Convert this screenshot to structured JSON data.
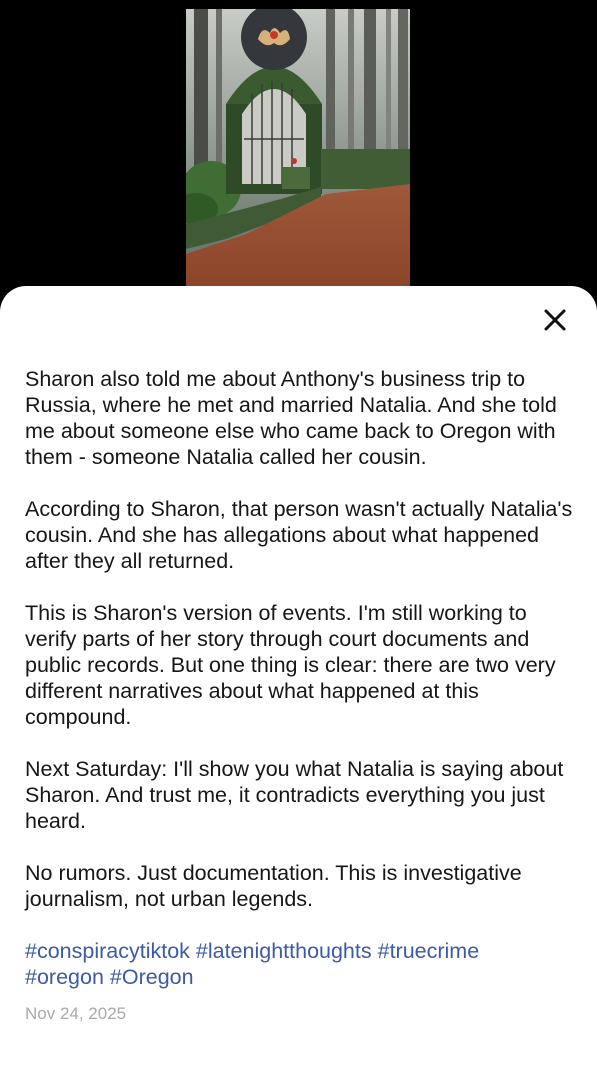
{
  "caption": {
    "paragraphs": [
      "Sharon also told me about Anthony's business trip to Russia, where he met and married Natalia. And she told me about someone else who came back to Oregon with them - someone Natalia called her cousin.",
      "According to Sharon, that person wasn't actually Natalia's cousin. And she has allegations about what happened after they all returned.",
      "This is Sharon's version of events. I'm still working to verify parts of her story through court documents and public records. But one thing is clear: there are two very different narratives about what happened at this compound.",
      "Next Saturday: I'll show you what Natalia is saying about Sharon. And trust me, it contradicts everything you just heard.",
      "No rumors. Just documentation. This is investigative journalism, not urban legends."
    ],
    "hashtags": [
      "#conspiracytiktok",
      "#latenightthoughts",
      "#truecrime",
      "#oregon",
      "#Oregon"
    ],
    "date": "Nov 24, 2025"
  },
  "icons": {
    "close": "close-icon"
  },
  "colors": {
    "hashtag": "#3b5ba5",
    "text": "#161616",
    "date": "#a9a9ad",
    "background_top": "#000000",
    "sheet": "#ffffff"
  }
}
